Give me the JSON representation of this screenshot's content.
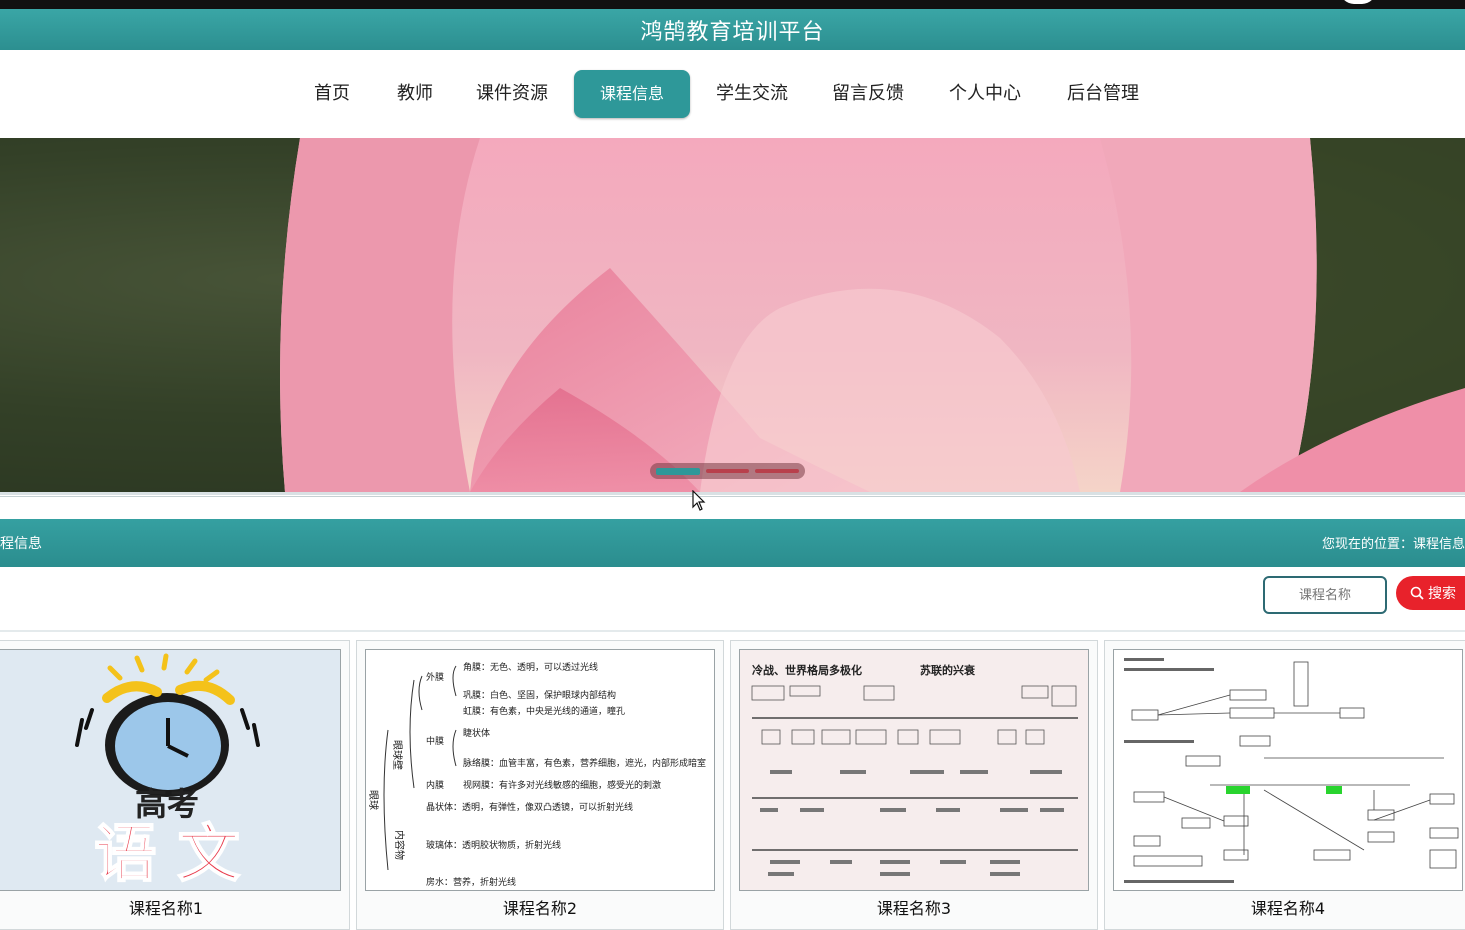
{
  "site": {
    "title": "鸿鹄教育培训平台"
  },
  "nav": {
    "items": [
      {
        "label": "首页"
      },
      {
        "label": "教师"
      },
      {
        "label": "课件资源"
      },
      {
        "label": "课程信息",
        "active": true
      },
      {
        "label": "学生交流"
      },
      {
        "label": "留言反馈"
      },
      {
        "label": "个人中心"
      },
      {
        "label": "后台管理"
      }
    ]
  },
  "banner": {
    "slides": 3,
    "active_slide": 1
  },
  "section": {
    "title": "课程信息",
    "breadcrumb": "您现在的位置：课程信息"
  },
  "search": {
    "placeholder": "课程名称",
    "button": "搜索"
  },
  "courses": [
    {
      "name": "课程名称1",
      "thumb": {
        "line1": "高考",
        "line2": "语 文"
      }
    },
    {
      "name": "课程名称2",
      "thumb": {
        "lines": [
          "外膜",
          "角膜：无色、透明，可以透过光线",
          "巩膜：白色、坚固，保护眼球内部结构",
          "虹膜：有色素，中央是光线的通道，瞳孔",
          "中膜",
          "睫状体",
          "脉络膜：血管丰富，有色素，营养细胞，遮光，内部形成暗室",
          "内膜",
          "视网膜：有许多对光线敏感的细胞，感受光的刺激",
          "晶状体：透明，有弹性，像双凸透镜，可以折射光线",
          "玻璃体：透明胶状物质，折射光线",
          "房水：营养，折射光线",
          "眼球壁",
          "眼球",
          "内容物"
        ]
      }
    },
    {
      "name": "课程名称3",
      "thumb": {
        "title": "冷战、世界格局多极化",
        "subtitle": "苏联的兴衰"
      }
    },
    {
      "name": "课程名称4",
      "thumb": {}
    }
  ],
  "colors": {
    "teal": "#2e9899",
    "search_red": "#e8222b"
  }
}
